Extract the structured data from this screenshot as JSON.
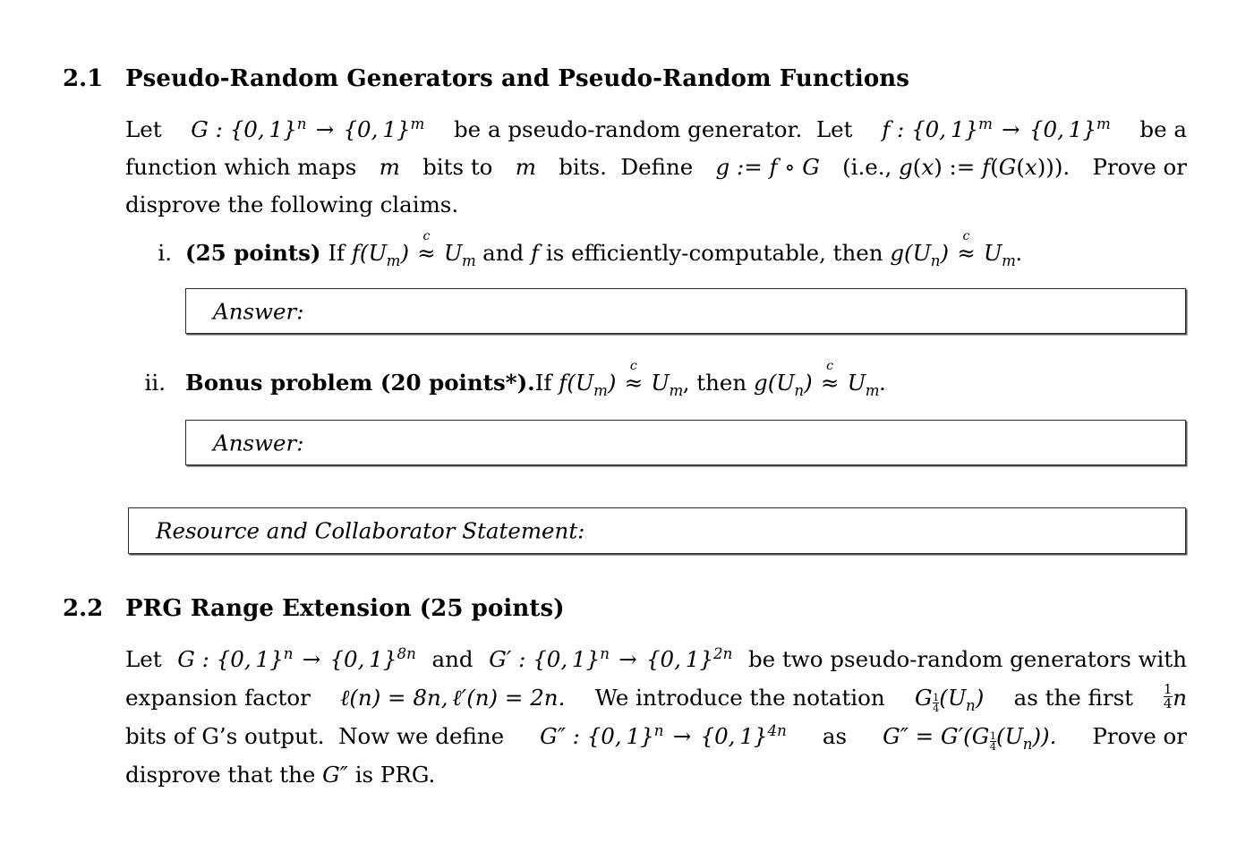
{
  "document": {
    "type": "homework-assignment",
    "font_style": "latex-computer-modern-serif",
    "background_color": "#ffffff",
    "text_color": "#000000"
  },
  "sections": [
    {
      "number": "2.1",
      "title": "Pseudo-Random Generators and Pseudo-Random Functions",
      "intro_lines": [
        "Let G : {0,1}^n → {0,1}^m be a pseudo-random generator. Let f : {0,1}^m → {0,1}^m be a",
        "function which maps m bits to m bits. Define g := f ∘ G (i.e., g(x) := f(G(x))). Prove or",
        "disprove the following claims."
      ],
      "items": [
        {
          "marker": "i.",
          "points_label": "(25 points)",
          "text": "If f(U_m) ≈c U_m and f is efficiently-computable, then g(U_n) ≈c U_m.",
          "answer_box_label": "Answer:"
        },
        {
          "marker": "ii.",
          "points_label": "Bonus problem (20 points*).",
          "text": "If f(U_m) ≈c U_m, then g(U_n) ≈c U_m.",
          "answer_box_label": "Answer:"
        }
      ],
      "statement_box_label": "Resource and Collaborator Statement:"
    },
    {
      "number": "2.2",
      "title": "PRG Range Extension (25 points)",
      "intro_lines": [
        "Let G : {0,1}^n → {0,1}^8n and G′ : {0,1}^n → {0,1}^2n be two pseudo-random generators with",
        "expansion factor ℓ(n) = 8n, ℓ′(n) = 2n. We introduce the notation G_{1/4}(U_n) as the first (1/4)n",
        "bits of G’s output. Now we define G″ : {0,1}^n → {0,1}^4n as G″ = G′(G_{1/4}(U_n)). Prove or",
        "disprove that the G″ is PRG."
      ]
    }
  ],
  "text": {
    "sec21_num": "2.1",
    "sec21_title": "Pseudo-Random Generators and Pseudo-Random Functions",
    "sec22_num": "2.2",
    "sec22_title": "PRG Range Extension (25 points)",
    "item_i_marker": "i.",
    "item_ii_marker": "ii.",
    "points_25": "(25 points)",
    "bonus_label": "Bonus problem (20 points*).",
    "answer_label_1": "Answer:",
    "answer_label_2": "Answer:",
    "resource_label": "Resource and Collaborator Statement:",
    "p1_l1_a": "Let",
    "p1_l1_b": "be a pseudo-random generator.  Let",
    "p1_l1_c": "be a",
    "p1_l2_a": "function which maps",
    "p1_l2_b": "bits to",
    "p1_l2_c": "bits.  Define",
    "p1_l2_d": "Prove or",
    "p1_l3": "disprove the following claims.",
    "item_i_if": "If",
    "item_i_and": "and",
    "item_i_eff": "is efficiently-computable, then",
    "item_ii_if": "If",
    "item_ii_then": ", then",
    "p2_l1_a": "Let",
    "p2_l1_b": "and",
    "p2_l1_c": "be two pseudo-random generators with",
    "p2_l2_a": "expansion factor",
    "p2_l2_b": "We introduce the notation",
    "p2_l2_c": "as the first",
    "p2_l3_a": "bits of G’s output.  Now we define",
    "p2_l3_b": "as",
    "p2_l3_c": "Prove or",
    "p2_l4_a": "disprove that the",
    "p2_l4_b": "is PRG."
  }
}
